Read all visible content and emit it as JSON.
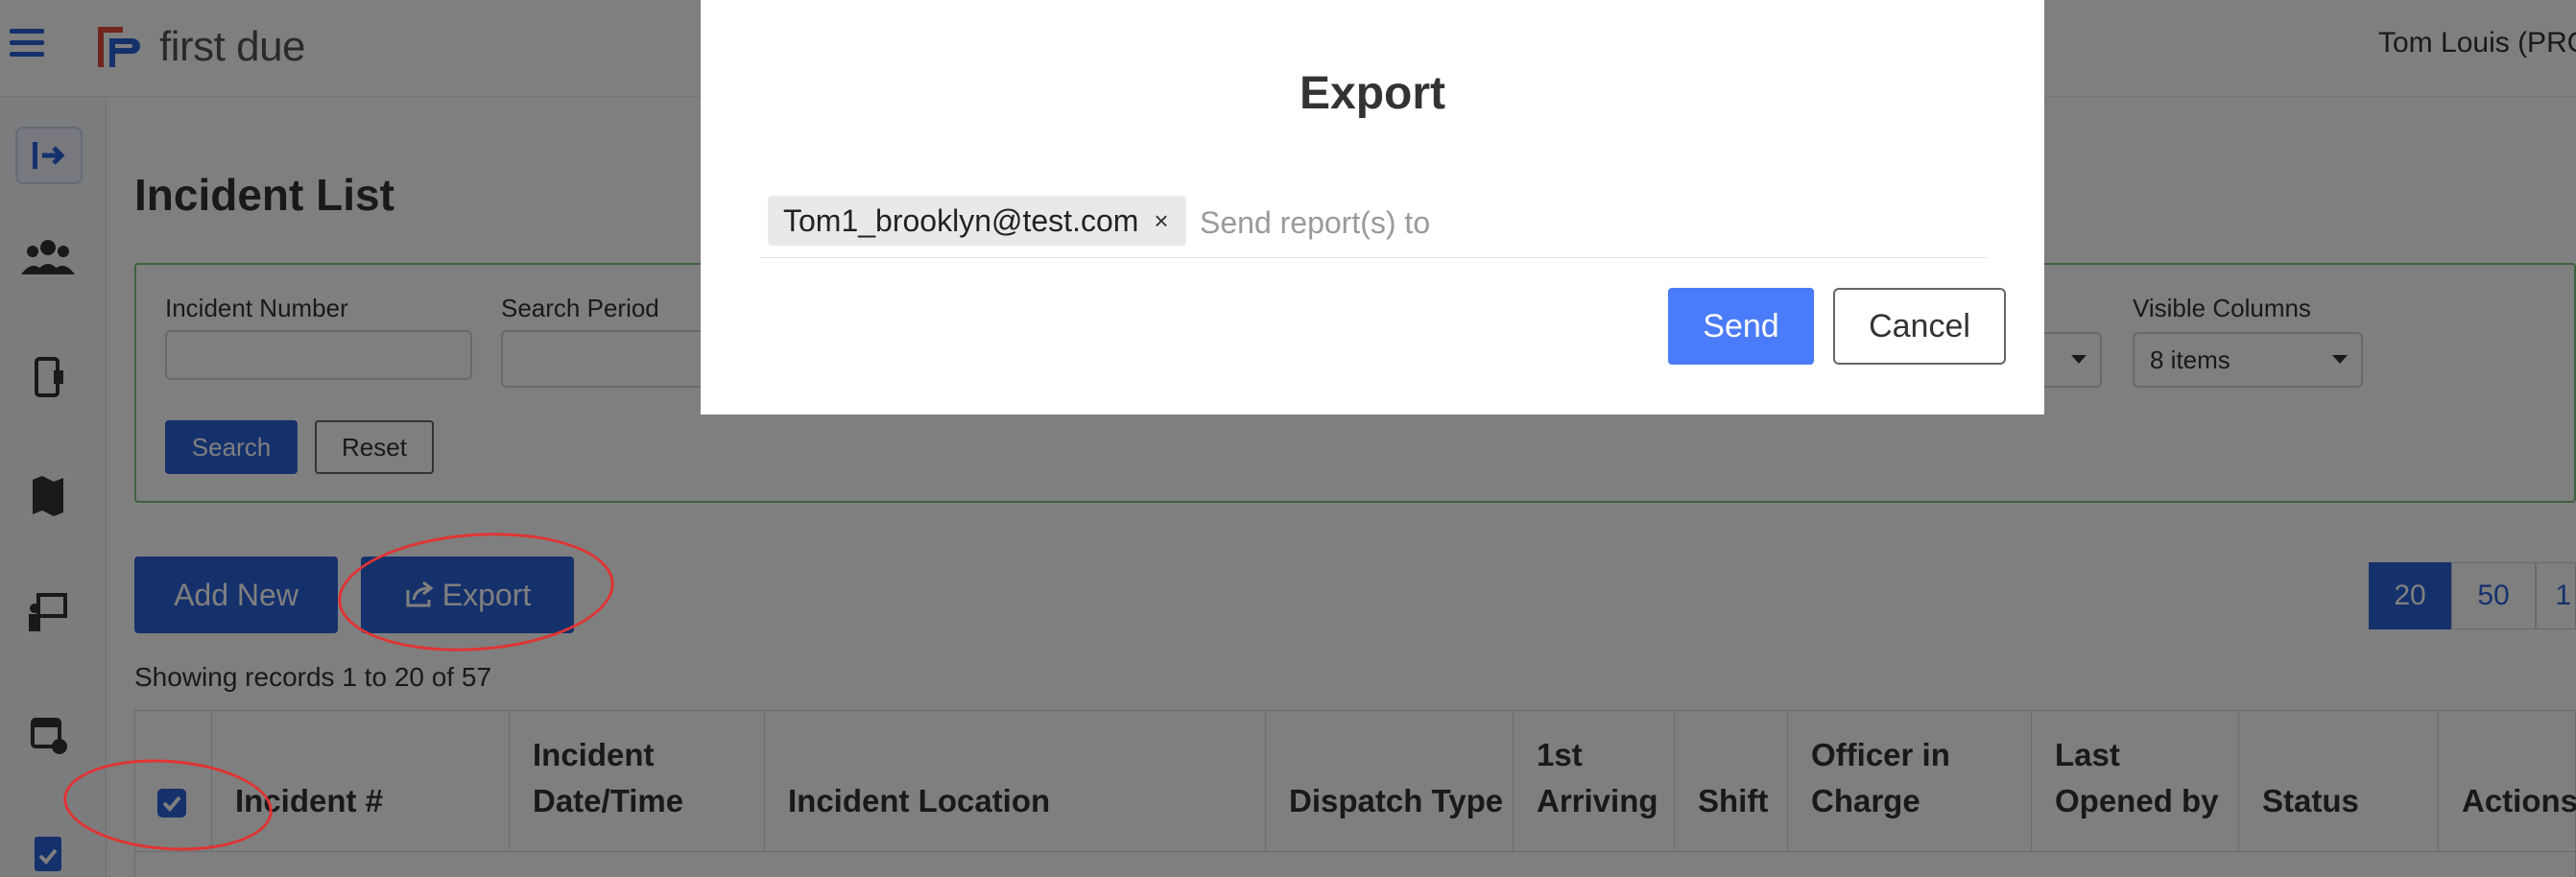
{
  "app": {
    "brand": "first due",
    "user": "Tom Louis (PRO"
  },
  "page": {
    "title": "Incident List",
    "records_text": "Showing records 1 to 20 of 57"
  },
  "filters": {
    "incident_number_label": "Incident Number",
    "search_period_label": "Search Period",
    "visible_columns_label": "Visible Columns",
    "visible_columns_value": "8 items",
    "search_label": "Search",
    "reset_label": "Reset"
  },
  "actions": {
    "add_new_label": "Add New",
    "export_label": "Export"
  },
  "pager": [
    "20",
    "50",
    "1"
  ],
  "table": {
    "headers": [
      "Incident #",
      "Incident Date/Time",
      "Incident Location",
      "Dispatch Type",
      "1st Arriving",
      "Shift",
      "Officer in Charge",
      "Last Opened by",
      "Status",
      "Actions"
    ]
  },
  "modal": {
    "title": "Export",
    "recipient_tag": "Tom1_brooklyn@test.com",
    "tag_remove": "×",
    "input_placeholder": "Send report(s) to",
    "send_label": "Send",
    "cancel_label": "Cancel"
  },
  "icons": {
    "menu": "hamburger-menu-icon",
    "logo": "first-due-logo-icon",
    "collapse": "sidebar-collapse-icon",
    "people": "people-icon",
    "device": "mobile-device-icon",
    "map": "map-icon",
    "training": "presentation-icon",
    "calendar": "calendar-icon",
    "document": "document-check-icon",
    "export": "share-export-icon"
  },
  "colors": {
    "primary": "#2b63d9",
    "send": "#4a7bfa",
    "annotation": "#e03434",
    "filter_border": "#7fc17f"
  }
}
